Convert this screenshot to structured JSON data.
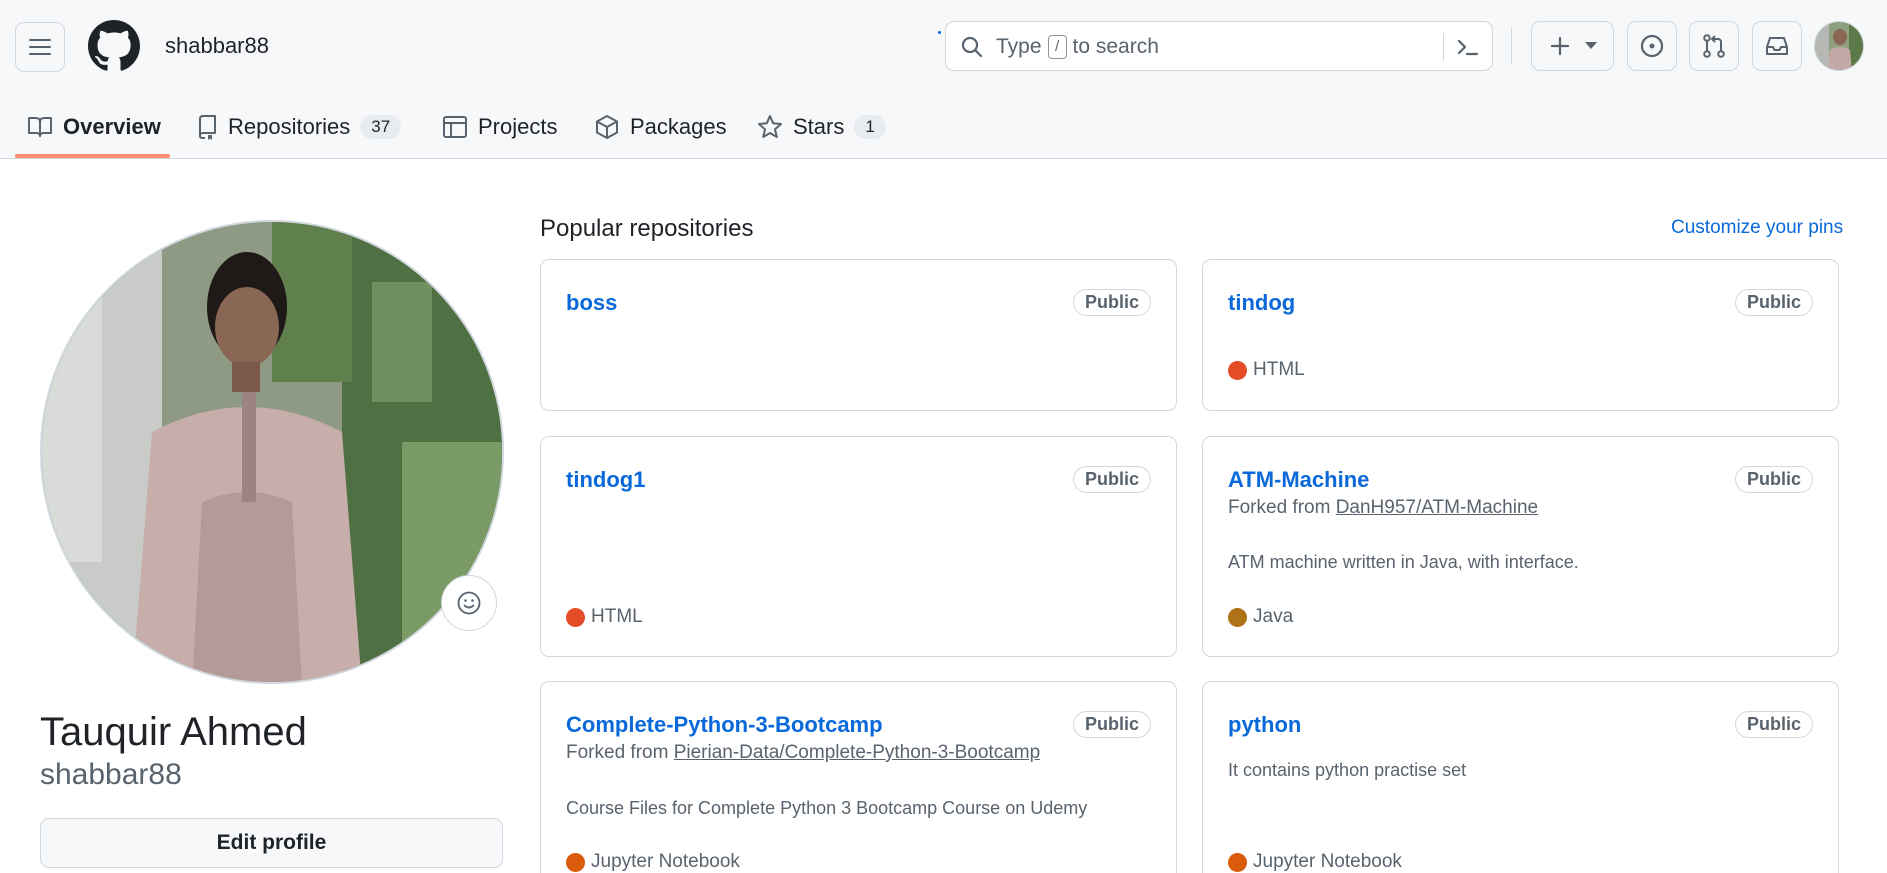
{
  "header": {
    "username": "shabbar88",
    "search_prefix": "Type",
    "search_key": "/",
    "search_suffix": "to search"
  },
  "tabs": [
    {
      "label": "Overview",
      "active": true
    },
    {
      "label": "Repositories",
      "count": "37"
    },
    {
      "label": "Projects"
    },
    {
      "label": "Packages"
    },
    {
      "label": "Stars",
      "count": "1"
    }
  ],
  "profile": {
    "full_name": "Tauquir Ahmed",
    "login": "shabbar88",
    "edit_label": "Edit profile"
  },
  "popular": {
    "title": "Popular repositories",
    "customize_label": "Customize your pins",
    "repos": [
      {
        "name": "boss",
        "visibility": "Public"
      },
      {
        "name": "tindog",
        "visibility": "Public",
        "language": "HTML",
        "language_color": "#e34c26"
      },
      {
        "name": "tindog1",
        "visibility": "Public",
        "language": "HTML",
        "language_color": "#e34c26"
      },
      {
        "name": "ATM-Machine",
        "visibility": "Public",
        "forked_prefix": "Forked from",
        "forked_from": "DanH957/ATM-Machine",
        "description": "ATM machine written in Java, with interface.",
        "language": "Java",
        "language_color": "#b07219"
      },
      {
        "name": "Complete-Python-3-Bootcamp",
        "visibility": "Public",
        "forked_prefix": "Forked from",
        "forked_from": "Pierian-Data/Complete-Python-3-Bootcamp",
        "description": "Course Files for Complete Python 3 Bootcamp Course on Udemy",
        "language": "Jupyter Notebook",
        "language_color": "#da5b0b"
      },
      {
        "name": "python",
        "visibility": "Public",
        "description": "It contains python practise set",
        "language": "Jupyter Notebook",
        "language_color": "#da5b0b"
      }
    ]
  },
  "colors": {
    "accent": "#0969da",
    "tab_underline": "#fd8c73",
    "html": "#e34c26",
    "java": "#b07219",
    "jupyter": "#da5b0b"
  },
  "icons": [
    "hamburger-icon",
    "github-logo-icon",
    "search-icon",
    "command-palette-icon",
    "plus-icon",
    "chevron-down-icon",
    "issues-icon",
    "pull-requests-icon",
    "inbox-icon",
    "book-icon",
    "repo-icon",
    "table-icon",
    "package-icon",
    "star-icon",
    "smiley-icon"
  ]
}
